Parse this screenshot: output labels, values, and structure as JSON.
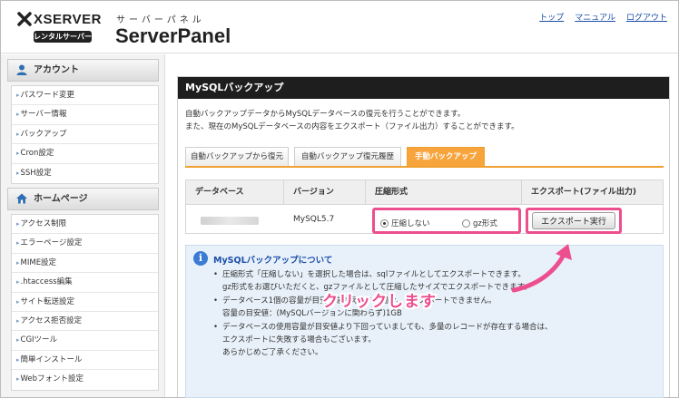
{
  "logo": {
    "brand": "XSERVER",
    "badge": "レンタルサーバー"
  },
  "header": {
    "subtitle_kana": "サーバーパネル",
    "title": "ServerPanel"
  },
  "top_links": [
    "トップ",
    "マニュアル",
    "ログアウト"
  ],
  "sidebar": {
    "account": {
      "heading": "アカウント",
      "items": [
        "パスワード変更",
        "サーバー情報",
        "バックアップ",
        "Cron設定",
        "SSH設定"
      ]
    },
    "homepage": {
      "heading": "ホームページ",
      "items": [
        "アクセス制限",
        "エラーページ設定",
        "MIME設定",
        ".htaccess編集",
        "サイト転送設定",
        "アクセス拒否設定",
        "CGIツール",
        "簡単インストール",
        "Webフォント設定"
      ]
    }
  },
  "panel": {
    "title": "MySQLバックアップ",
    "description": [
      "自動バックアップデータからMySQLデータベースの復元を行うことができます。",
      "また、現在のMySQLデータベースの内容をエクスポート（ファイル出力）することができます。"
    ],
    "tabs": [
      "自動バックアップから復元",
      "自動バックアップ復元履歴",
      "手動バックアップ"
    ],
    "active_tab": 2,
    "table": {
      "headers": [
        "データベース",
        "バージョン",
        "圧縮形式",
        "エクスポート(ファイル出力)"
      ],
      "row": {
        "version": "MySQL5.7",
        "compression_options": [
          "圧縮しない",
          "gz形式"
        ],
        "selected_compression": 0,
        "export_button": "エクスポート実行"
      }
    },
    "info": {
      "title": "MySQLバックアップについて",
      "lines": [
        {
          "bullet": true,
          "text": "圧縮形式「圧縮しない」を選択した場合は、sqlファイルとしてエクスポートできます。"
        },
        {
          "bullet": false,
          "text": "gz形式をお選びいただくと、gzファイルとして圧縮したサイズでエクスポートできます。"
        },
        {
          "bullet": true,
          "text": "データベース1個の容量が目安値を超えている場合、エクスポートできません。"
        },
        {
          "bullet": false,
          "text": "容量の目安値：(MySQLバージョンに関わらず)1GB"
        },
        {
          "bullet": true,
          "text": "データベースの使用容量が目安値より下回っていましても、多量のレコードが存在する場合は、"
        },
        {
          "bullet": false,
          "text": "エクスポートに失敗する場合もございます。"
        },
        {
          "bullet": false,
          "text": "あらかじめご了承ください。"
        }
      ]
    }
  },
  "annotation": "クリックします",
  "colors": {
    "accent_tab": "#f7a43d",
    "highlight": "#ec4e8e",
    "link": "#1a4ea8",
    "title_bar": "#1e1e1e"
  }
}
